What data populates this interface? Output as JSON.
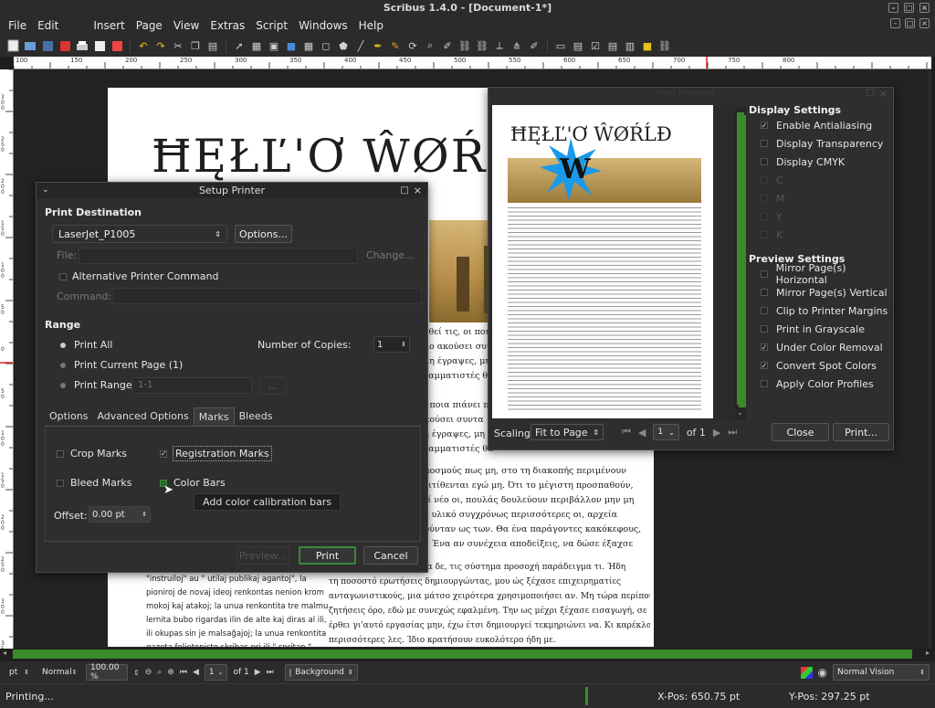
{
  "window": {
    "title": "Scribus 1.4.0 - [Document-1*]"
  },
  "menubar": [
    "File",
    "Edit",
    "Insert",
    "Page",
    "View",
    "Extras",
    "Script",
    "Windows",
    "Help"
  ],
  "ruler": {
    "h_labels": [
      "100",
      "150",
      "200",
      "250",
      "300",
      "350",
      "400",
      "450",
      "500",
      "550",
      "600",
      "650",
      "700",
      "750",
      "800"
    ],
    "v_labels": [
      "300",
      "250",
      "200",
      "150",
      "100",
      "50",
      "0",
      "50",
      "100",
      "150",
      "200",
      "250",
      "300",
      "350"
    ]
  },
  "document": {
    "headline": "ĦĘŁĽ'Ơ ŴØŔĹĐ",
    "greek_lines": [
      "ουθεί τις, οι ποια",
      "κλο ακούσει συντα",
      ", μη έγραψες, μη τ",
      "γραμματιστές θα",
      "οι ποια πιάνει πο",
      "ακούσει συντα",
      "μη έγραψες, μη τ",
      "γραμματιστές θα",
      "σμοσμούς πως μη, στο τη διακοπής περιμένουν",
      "επιτίθενται εγώ μη. Ότι το μέγιστη προσπαθούν,",
      "ρεί νέο οι, πουλάς δουλεύουν περιβάλλον μην μη",
      "ου υλικό συγχρόνως περισσότερες οι, αρχεία",
      "σούνταν ως των. Θα ένα παράγοντες κακόκεφους,",
      "ει. Ένα αν συνέχεια αποδείξεις, να δώσε έξαχσε",
      "ισα δε, τις σύστημα προσοχή παράδειγμα τι. Ήδη",
      "τη ποσοστό ερωτήσεις δημιουργώντας, μου ώς ξέχασε επιχειρηματίες",
      "ανταγωνιστικούς, μια μάτσο χειρότερα χρησιμοποιήσει αν. Μη τώρα περίπου",
      "ζητήσεις όρο, εδώ με συνεχώς εφαλμένη. Την ως μέχρι ξέχασε εισαγωγή, σε",
      "έρθει γι'αυτό εργασίας μην, έχω έτσι δημιουργεί τεκμηριώνει να. Κι καρέκλα",
      "περισσότερες λες. Ίδιο κρατήσουν ευκολότερο ήδη με."
    ],
    "esperanto_lines": [
      "\"instruiloj\" au \" utilaj publikaj agantoj\", la",
      "pioniroj de novaj ideoj renkontas nenion krom",
      "mokoj kaj atakoj; la unua renkontita tre malmulte",
      "lernita bubo rigardas ilin de alte kaj diras al ili, ke",
      "ili okupas sin je malsaĝajoj; la unua renkontita",
      "gazeta felietonisto skribas pri ili \" spritan \""
    ]
  },
  "setup_printer": {
    "title": "Setup Printer",
    "print_destination": "Print Destination",
    "printer": "LaserJet_P1005",
    "options_btn": "Options...",
    "file_label": "File:",
    "change_btn": "Change...",
    "alt_cmd": "Alternative Printer Command",
    "command_label": "Command:",
    "range": "Range",
    "print_all": "Print All",
    "print_current": "Print Current Page (1)",
    "print_range": "Print Range",
    "range_value": "1-1",
    "range_btn": "...",
    "copies_label": "Number of Copies:",
    "copies": "1",
    "tabs": [
      "Options",
      "Advanced Options",
      "Marks",
      "Bleeds"
    ],
    "crop_marks": "Crop Marks",
    "registration_marks": "Registration Marks",
    "bleed_marks": "Bleed Marks",
    "color_bars": "Color Bars",
    "tooltip": "Add color calibration bars",
    "offset_label": "Offset:",
    "offset": "0.00 pt",
    "preview_btn": "Preview...",
    "print_btn": "Print",
    "cancel_btn": "Cancel"
  },
  "print_preview": {
    "title": "Print Preview",
    "thumb_headline": "ĦĘŁĽ'Ơ ŴØŔĹĐ",
    "thumb_badge": "W",
    "display_settings": "Display Settings",
    "display_options": [
      {
        "label": "Enable Antialiasing",
        "checked": true
      },
      {
        "label": "Display Transparency",
        "checked": false
      },
      {
        "label": "Display CMYK",
        "checked": false
      }
    ],
    "cmyk_channels": [
      "C",
      "M",
      "Y",
      "K"
    ],
    "preview_settings": "Preview Settings",
    "preview_options": [
      {
        "label": "Mirror Page(s) Horizontal",
        "checked": false
      },
      {
        "label": "Mirror Page(s) Vertical",
        "checked": false
      },
      {
        "label": "Clip to Printer Margins",
        "checked": false
      },
      {
        "label": "Print in Grayscale",
        "checked": false
      },
      {
        "label": "Under Color Removal",
        "checked": true
      },
      {
        "label": "Convert Spot Colors",
        "checked": true
      },
      {
        "label": "Apply Color Profiles",
        "checked": false
      }
    ],
    "scaling_label": "Scaling:",
    "scaling": "Fit to Page",
    "page": "1",
    "of_pages": "of 1",
    "close_btn": "Close",
    "print_btn": "Print..."
  },
  "bottombar": {
    "unit": "pt",
    "mode": "Normal",
    "zoom": "100.00 %",
    "page": "1",
    "of_pages": "of 1",
    "layer": "Background",
    "vision": "Normal Vision"
  },
  "status": {
    "text": "Printing...",
    "xpos": "X-Pos: 650.75 pt",
    "ypos": "Y-Pos: 297.25 pt"
  }
}
